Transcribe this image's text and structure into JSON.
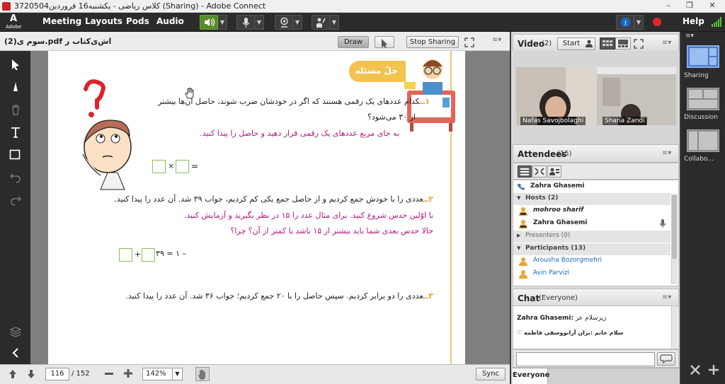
{
  "window": {
    "title": "3720504کلاس ریاضی - یکشنبه16 فروردین (Sharing) - Adobe Connect",
    "controls": [
      "–",
      "❐",
      "✕"
    ]
  },
  "menubar": {
    "logo_text": "Adobe",
    "items": [
      "Meeting",
      "Layouts",
      "Pods",
      "Audio"
    ],
    "help": "Help"
  },
  "share": {
    "file_name": "سوم ی(2).pdf اش‌ی‌کتاب ر",
    "draw_label": "Draw",
    "stop_sharing_label": "Stop Sharing",
    "page_current": "116",
    "page_total": "/ 152",
    "zoom": "142%",
    "sync_label": "Sync"
  },
  "document": {
    "header_badge": "حلّ مسئله",
    "q1_num": "۱ــ",
    "q1_line1": "کدام عددهای یک رقمی هستند که اگر در خودشان ضرب شوند، حاصل آن‌ها بیشتر",
    "q1_line2": "از ۳۰ می‌شود؟",
    "q1_hint": "به جای مربع عددهای یک رقمی قرار دهید و حاصل را پیدا کنید.",
    "q1_eq_op": "×",
    "q1_eq_end": "=",
    "q2_num": "۲ــ",
    "q2_line1": "عددی را با خودش جمع کردیم و از حاصل جمع یکی کم کردیم، جواب ۳۹ شد. آن عدد را پیدا کنید.",
    "q2_hint1": "با اوّلین حدس شروع کنید. برای مثال عدد را ۱۵ در نظر بگیرید و آزمایش کنید.",
    "q2_hint2": "حالا حدس بعدی شما باید بیشتر از ۱۵ باشد یا کمتر از آن؟ چرا؟",
    "q2_eq_plus": "+",
    "q2_eq_rest": "– ۱ = ۳۹",
    "q3_num": "۳ــ",
    "q3_line1": "عددی را دو برابر کردیم. سپس حاصل را با ۲۰ جمع کردیم؛ جواب ۳۶ شد. آن عدد را پیدا کنید."
  },
  "video": {
    "title": "Video",
    "count": "(2)",
    "start_label": "Start",
    "participants": [
      {
        "name": "Nafas Savojbolaghi"
      },
      {
        "name": "Shana Zandi"
      }
    ]
  },
  "attendees": {
    "title": "Attendees",
    "count": "(15)",
    "current_user": "Zahra Ghasemi",
    "hosts_label": "Hosts (2)",
    "hosts": [
      "mohroo sharif",
      "Zahra Ghasemi"
    ],
    "presenters_label": "Presenters (0)",
    "participants_label": "Participants (13)",
    "participants": [
      "Arousha Bozorgmehri",
      "Avin Parvizi"
    ]
  },
  "chat": {
    "title": "Chat",
    "scope": "(Everyone)",
    "messages": [
      {
        "sender": "Zahra Ghasemi:",
        "text": "زیزسلام عز"
      },
      {
        "sender": "",
        "text": "♡ سلام خانم :بران آرانووسفی فاطمه"
      }
    ],
    "tab_label": "Everyone"
  },
  "layouts": {
    "items": [
      "Sharing",
      "Discussion",
      "Collabo..."
    ]
  },
  "colors": {
    "magenta_text": "#b2187e",
    "badge_yellow": "#f3c34f",
    "box_green": "#8cbf5a",
    "accent_blue": "#1a66c0"
  }
}
